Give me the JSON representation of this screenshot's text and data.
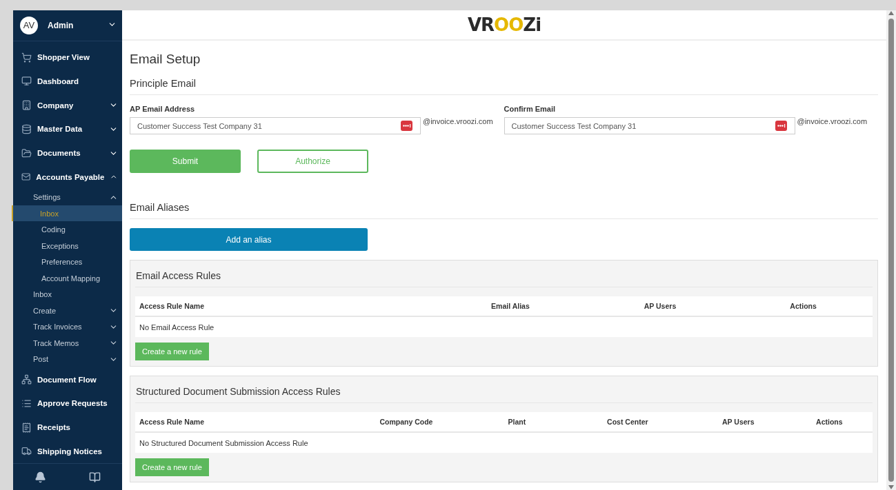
{
  "user": {
    "initials": "AV",
    "name": "Admin",
    "expanded": false
  },
  "sidebar": {
    "items": [
      {
        "label": "Shopper View",
        "expandable": false
      },
      {
        "label": "Dashboard",
        "expandable": false
      },
      {
        "label": "Company",
        "expandable": true,
        "expanded": false
      },
      {
        "label": "Master Data",
        "expandable": true,
        "expanded": false
      },
      {
        "label": "Documents",
        "expandable": true,
        "expanded": false
      },
      {
        "label": "Accounts Payable",
        "expandable": true,
        "expanded": true,
        "children": [
          {
            "label": "Settings",
            "expandable": true,
            "expanded": true,
            "children": [
              {
                "label": "Inbox",
                "selected": true
              },
              {
                "label": "Coding",
                "selected": false
              },
              {
                "label": "Exceptions",
                "selected": false
              },
              {
                "label": "Preferences",
                "selected": false
              },
              {
                "label": "Account Mapping",
                "selected": false
              }
            ]
          },
          {
            "label": "Inbox",
            "expandable": false
          },
          {
            "label": "Create",
            "expandable": true,
            "expanded": false
          },
          {
            "label": "Track Invoices",
            "expandable": true,
            "expanded": false
          },
          {
            "label": "Track Memos",
            "expandable": true,
            "expanded": false
          },
          {
            "label": "Post",
            "expandable": true,
            "expanded": false
          }
        ]
      },
      {
        "label": "Document Flow",
        "expandable": false
      },
      {
        "label": "Approve Requests",
        "expandable": false
      },
      {
        "label": "Receipts",
        "expandable": false
      },
      {
        "label": "Shipping Notices",
        "expandable": false
      }
    ]
  },
  "logo": [
    {
      "text": "VR",
      "accent": false
    },
    {
      "text": "OO",
      "accent": true
    },
    {
      "text": "Zi",
      "accent": false
    }
  ],
  "page_title": "Email Setup",
  "principle": {
    "heading": "Principle Email",
    "fields": [
      {
        "label": "AP Email Address",
        "value": "Customer Success Test Company 31",
        "suffix": "@invoice.vroozi.com"
      },
      {
        "label": "Confirm Email",
        "value": "Customer Success Test Company 31",
        "suffix": "@invoice.vroozi.com"
      }
    ],
    "buttons": [
      {
        "label": "Submit",
        "kind": "solid"
      },
      {
        "label": "Authorize",
        "kind": "outline"
      }
    ]
  },
  "aliases": {
    "heading": "Email Aliases",
    "button": "Add an alias"
  },
  "panels": [
    {
      "title": "Email Access Rules",
      "columns": [
        "Access Rule Name",
        "Email Alias",
        "AP Users",
        "Actions"
      ],
      "empty": "No Email Access Rule",
      "button": "Create a new rule"
    },
    {
      "title": "Structured Document Submission Access Rules",
      "columns": [
        "Access Rule Name",
        "Company Code",
        "Plant",
        "Cost Center",
        "AP Users",
        "Actions"
      ],
      "empty": "No Structured Document Submission Access Rule",
      "button": "Create a new rule"
    }
  ]
}
